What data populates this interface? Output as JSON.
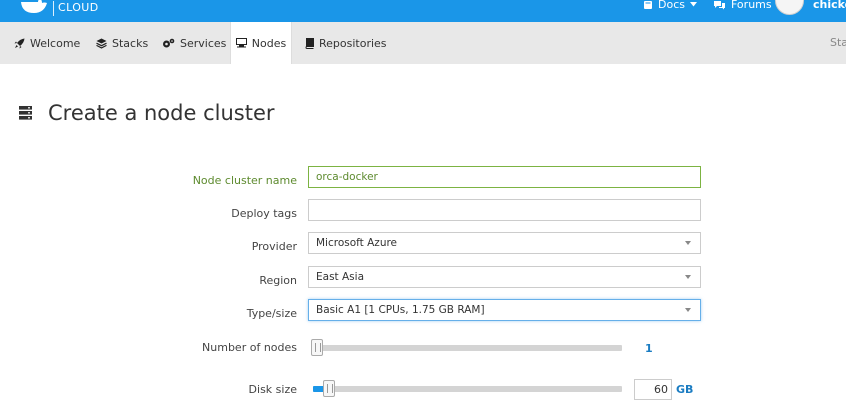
{
  "brand": {
    "logo_text": "CLOUD",
    "primary_color": "#1a96e8"
  },
  "topnav": {
    "docs_label": "Docs",
    "forums_label": "Forums",
    "username": "chicken"
  },
  "tabs": [
    {
      "label": "Welcome",
      "icon": "rocket-icon"
    },
    {
      "label": "Stacks",
      "icon": "stack-layers-icon"
    },
    {
      "label": "Services",
      "icon": "cogs-icon"
    },
    {
      "label": "Nodes",
      "icon": "server-icon",
      "active": true
    },
    {
      "label": "Repositories",
      "icon": "book-icon"
    }
  ],
  "tab_right_text": "Sta",
  "page": {
    "title": "Create a node cluster",
    "icon": "server-stack-icon"
  },
  "form": {
    "cluster_name": {
      "label": "Node cluster name",
      "value": "orca-docker"
    },
    "deploy_tags": {
      "label": "Deploy tags",
      "value": ""
    },
    "provider": {
      "label": "Provider",
      "value": "Microsoft Azure"
    },
    "region": {
      "label": "Region",
      "value": "East Asia"
    },
    "type_size": {
      "label": "Type/size",
      "value": "Basic A1 [1 CPUs, 1.75 GB RAM]"
    },
    "number_of_nodes": {
      "label": "Number of nodes",
      "value": "1",
      "slider_fraction": 0.0
    },
    "disk_size": {
      "label": "Disk size",
      "value": "60",
      "unit": "GB",
      "slider_fraction": 0.035
    }
  }
}
